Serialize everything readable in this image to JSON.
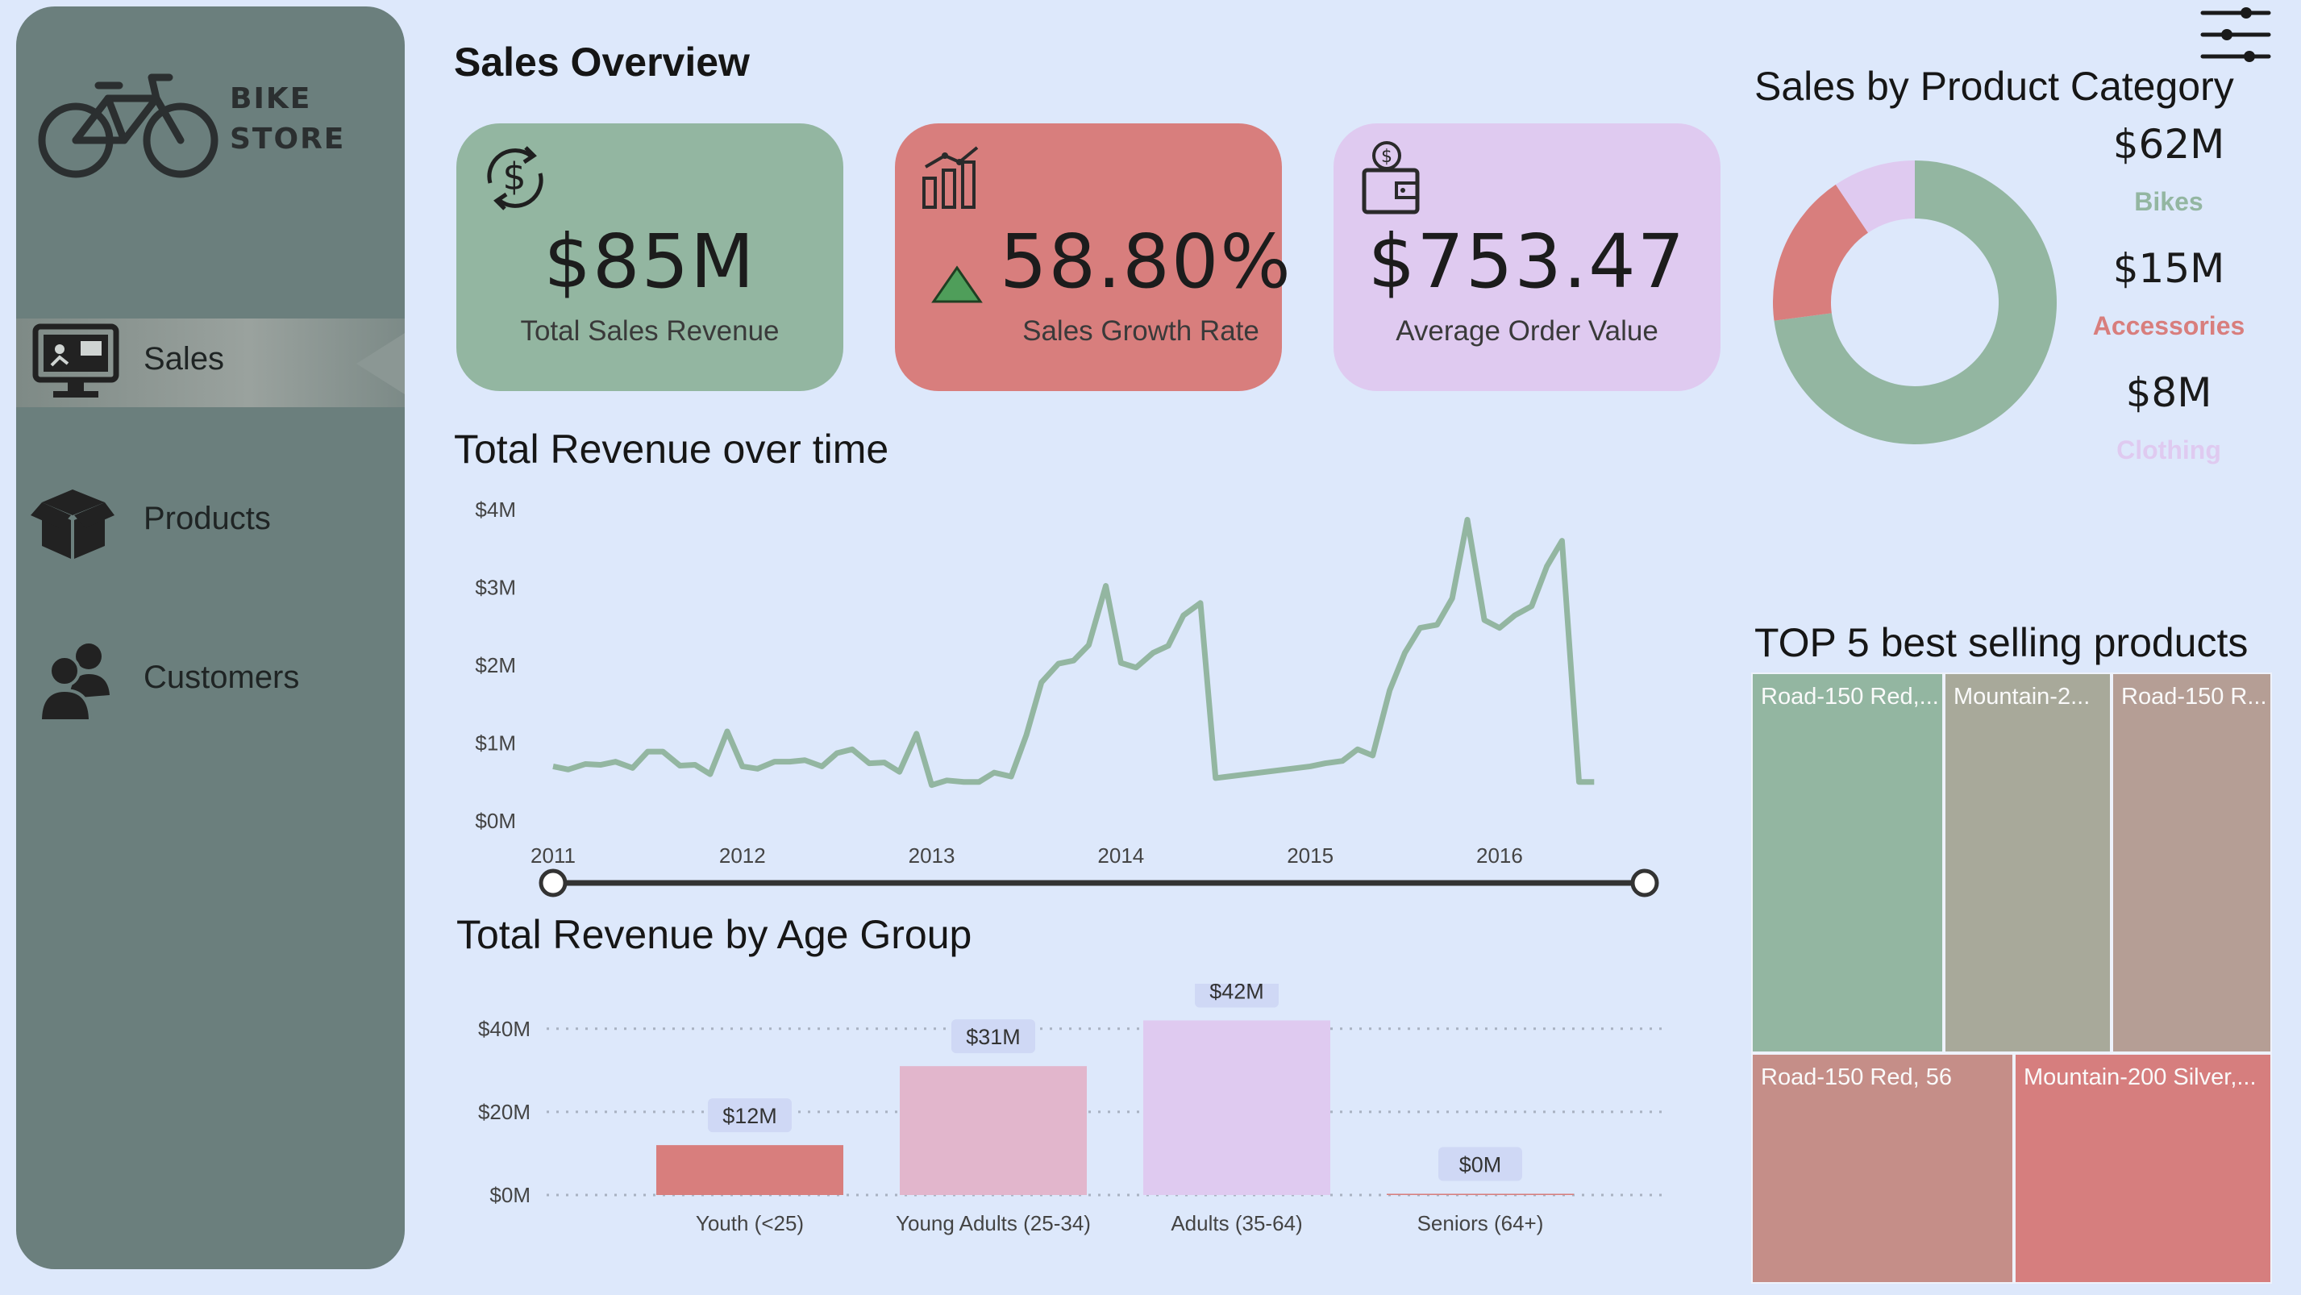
{
  "brand": {
    "line1": "BIKE",
    "line2": "STORE"
  },
  "nav": [
    {
      "label": "Sales",
      "icon": "monitor-chart-icon",
      "active": true
    },
    {
      "label": "Products",
      "icon": "box-icon",
      "active": false
    },
    {
      "label": "Customers",
      "icon": "users-icon",
      "active": false
    }
  ],
  "page_title": "Sales Overview",
  "kpis": {
    "sales": {
      "value": "$85M",
      "label": "Total Sales Revenue",
      "icon": "dollar-refresh-icon",
      "color": "#93b6a1"
    },
    "growth": {
      "value": "58.80%",
      "label": "Sales Growth Rate",
      "icon": "bar-chart-icon",
      "trend_icon": "triangle-up-icon",
      "color": "#d87e7d"
    },
    "aov": {
      "value": "$753.47",
      "label": "Average Order Value",
      "icon": "wallet-icon",
      "color": "#dfcaf0"
    }
  },
  "line_chart": {
    "title": "Total Revenue over time",
    "color": "#93b6a1"
  },
  "bar_chart": {
    "title": "Total Revenue by Age Group"
  },
  "donut": {
    "title": "Sales by Product Category"
  },
  "treemap": {
    "title": "TOP 5 best selling products",
    "cells": [
      {
        "label": "Road-150 Red,...",
        "color": "#93b6a1"
      },
      {
        "label": "Mountain-2...",
        "color": "#a8a99a"
      },
      {
        "label": "Road-150 R...",
        "color": "#b59e95"
      },
      {
        "label": "Road-150 Red, 56",
        "color": "#c58e88"
      },
      {
        "label": "Mountain-200 Silver,...",
        "color": "#d67e7e"
      }
    ]
  },
  "filter": {
    "icon": "sliders-icon"
  },
  "chart_data": [
    {
      "type": "line",
      "title": "Total Revenue over time",
      "x_ticks": [
        "2011",
        "2012",
        "2013",
        "2014",
        "2015",
        "2016"
      ],
      "y_ticks": [
        "$0M",
        "$1M",
        "$2M",
        "$3M",
        "$4M"
      ],
      "ylim": [
        0,
        4
      ],
      "xlim": [
        2011.0,
        2016.75
      ],
      "series": [
        {
          "x": [
            2011.0,
            2011.08,
            2011.17,
            2011.25,
            2011.33,
            2011.42,
            2011.5,
            2011.58,
            2011.67,
            2011.75,
            2011.83,
            2011.92,
            2012.0,
            2012.08,
            2012.17,
            2012.25,
            2012.33,
            2012.42,
            2012.5,
            2012.58,
            2012.67,
            2012.75,
            2012.83,
            2012.92,
            2013.0,
            2013.08,
            2013.17,
            2013.25,
            2013.33,
            2013.42,
            2013.5,
            2013.58,
            2013.67,
            2013.75,
            2013.83,
            2013.92,
            2014.0,
            2014.08,
            2014.17,
            2014.25,
            2014.33,
            2014.42,
            2014.5,
            2015.0,
            2015.08,
            2015.17,
            2015.25,
            2015.33,
            2015.42,
            2015.5,
            2015.58,
            2015.67,
            2015.75,
            2015.83,
            2015.92,
            2016.0,
            2016.08,
            2016.17,
            2016.25,
            2016.33,
            2016.42,
            2016.5
          ],
          "values": [
            0.7,
            0.66,
            0.73,
            0.72,
            0.76,
            0.68,
            0.89,
            0.89,
            0.71,
            0.72,
            0.6,
            1.15,
            0.7,
            0.67,
            0.76,
            0.76,
            0.78,
            0.7,
            0.87,
            0.92,
            0.74,
            0.75,
            0.63,
            1.12,
            0.46,
            0.52,
            0.5,
            0.5,
            0.62,
            0.57,
            1.1,
            1.78,
            2.02,
            2.06,
            2.26,
            3.02,
            2.03,
            1.97,
            2.16,
            2.25,
            2.64,
            2.8,
            0.55,
            0.7,
            0.74,
            0.77,
            0.92,
            0.84,
            1.68,
            2.16,
            2.48,
            2.52,
            2.86,
            3.87,
            2.58,
            2.48,
            2.64,
            2.76,
            3.27,
            3.6,
            0.5,
            0.5
          ],
          "name": ""
        }
      ]
    },
    {
      "type": "bar",
      "title": "Total Revenue by Age Group",
      "categories": [
        "Youth (<25)",
        "Young Adults (25-34)",
        "Adults (35-64)",
        "Seniors (64+)"
      ],
      "values": [
        12,
        31,
        42,
        0.3
      ],
      "data_labels": [
        "$12M",
        "$31M",
        "$42M",
        "$0M"
      ],
      "colors": [
        "#d87e7d",
        "#e2b6cc",
        "#dfcaf0",
        "#d87e7d"
      ],
      "y_ticks": [
        "$0M",
        "$20M",
        "$40M"
      ],
      "ylim": [
        0,
        45
      ]
    },
    {
      "type": "pie",
      "title": "Sales by Product Category",
      "categories": [
        "Bikes",
        "Accessories",
        "Clothing"
      ],
      "values": [
        62,
        15,
        8
      ],
      "data_labels": [
        "$62M",
        "$15M",
        "$8M"
      ],
      "colors": [
        "#93b6a1",
        "#d87e7d",
        "#dfcaf0"
      ]
    }
  ]
}
